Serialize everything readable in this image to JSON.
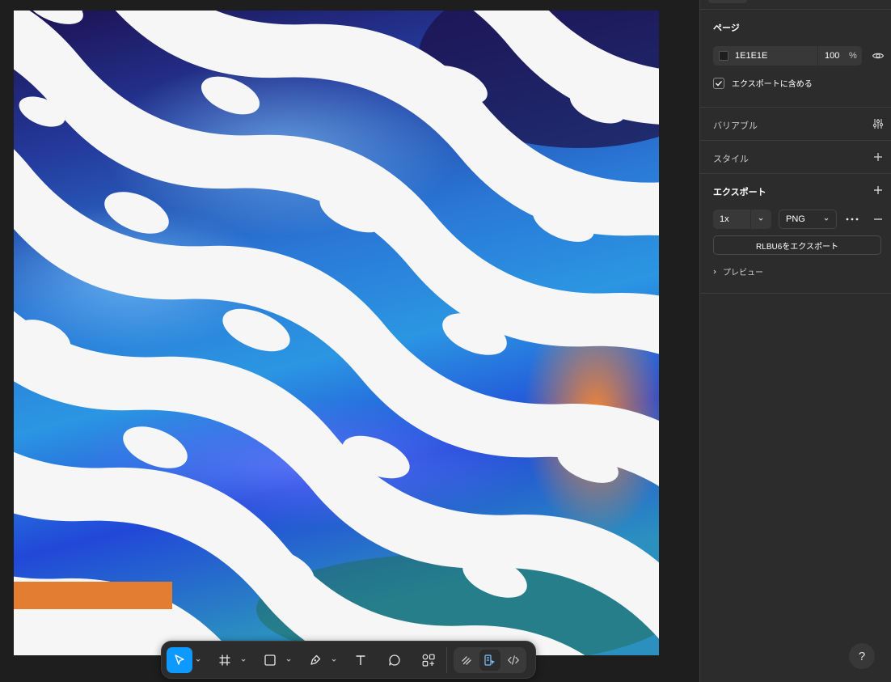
{
  "panel": {
    "page_section": {
      "title": "ページ",
      "fill_hex": "1E1E1E",
      "fill_color": "#1e1e1e",
      "opacity": "100",
      "opacity_unit": "%",
      "include_in_export_label": "エクスポートに含める",
      "include_in_export_checked": true
    },
    "variables_section": {
      "title": "バリアブル"
    },
    "styles_section": {
      "title": "スタイル"
    },
    "export_section": {
      "title": "エクスポート",
      "scale": "1x",
      "format": "PNG",
      "export_button_label": "RLBU6をエクスポート",
      "preview_label": "プレビュー"
    }
  },
  "canvas": {
    "background": "#f6f6f6",
    "accent_bar_color": "#e27d31",
    "pattern_colors": [
      "#241258",
      "#2a5bd0",
      "#2b8fe0",
      "#1f3fe6",
      "#f0e8e0"
    ]
  },
  "toolbar": {
    "tools": [
      {
        "icon": "move-icon",
        "active": true
      },
      {
        "icon": "frame-icon",
        "active": false
      },
      {
        "icon": "rectangle-icon",
        "active": false
      },
      {
        "icon": "pen-icon",
        "active": false
      },
      {
        "icon": "text-icon",
        "active": false
      },
      {
        "icon": "comment-icon",
        "active": false
      },
      {
        "icon": "actions-icon",
        "active": false
      }
    ],
    "modes": [
      {
        "icon": "draw-mode-icon",
        "active": false
      },
      {
        "icon": "design-mode-icon",
        "active": true
      },
      {
        "icon": "dev-mode-icon",
        "active": false
      }
    ]
  },
  "help_label": "?"
}
